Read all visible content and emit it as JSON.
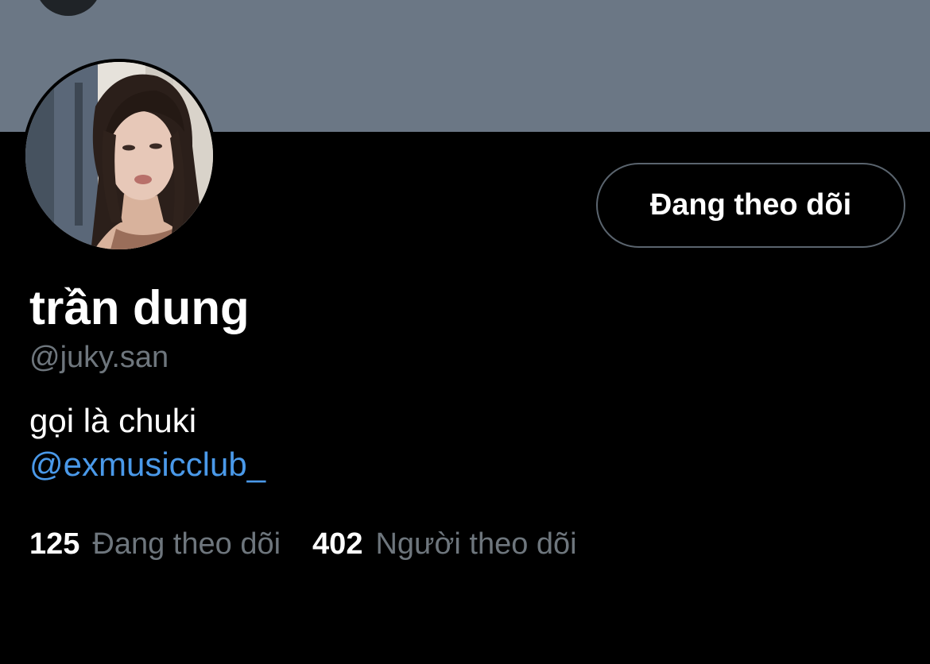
{
  "profile": {
    "display_name": "trần dung",
    "handle": "@juky.san",
    "bio": "gọi là chuki",
    "bio_mention": "@exmusicclub_",
    "follow_button_label": "Đang theo dõi"
  },
  "stats": {
    "following_count": "125",
    "following_label": "Đang theo dõi",
    "followers_count": "402",
    "followers_label": "Người theo dõi"
  },
  "colors": {
    "background": "#000000",
    "banner": "#6b7785",
    "text_primary": "#ffffff",
    "text_secondary": "#6e767d",
    "link": "#4a99e9",
    "button_border": "#5a646e"
  }
}
